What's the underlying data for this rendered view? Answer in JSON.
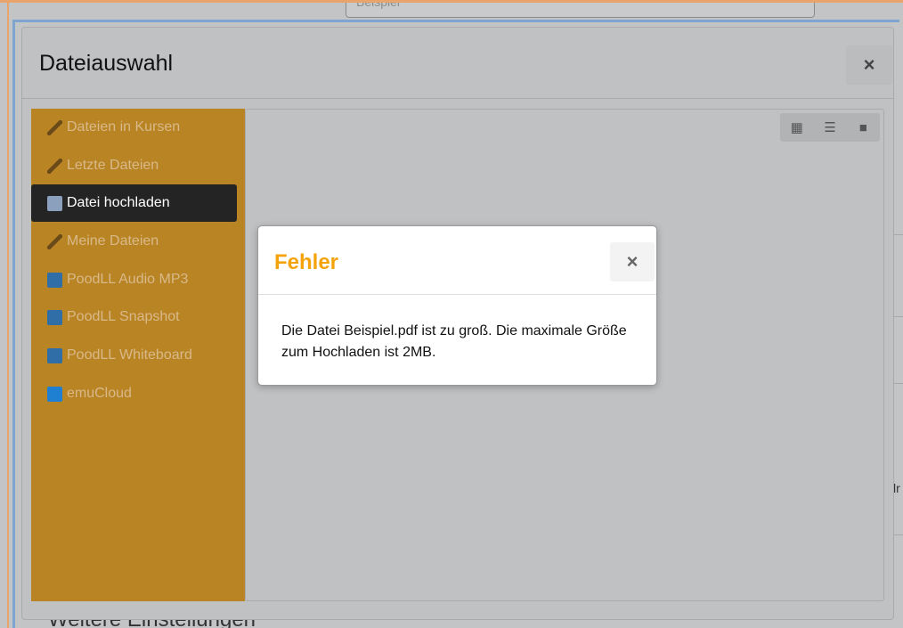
{
  "background": {
    "example_placeholder": "Beispiel",
    "more_settings": "Weitere Einstellungen",
    "right_fragment": "lr"
  },
  "modal": {
    "title": "Dateiauswahl",
    "close_label": "×"
  },
  "sidebar": {
    "items": [
      {
        "label": "Dateien in Kursen",
        "icon": "graduation-cap-icon",
        "active": false
      },
      {
        "label": "Letzte Dateien",
        "icon": "graduation-cap-icon",
        "active": false
      },
      {
        "label": "Datei hochladen",
        "icon": "upload-icon",
        "active": true
      },
      {
        "label": "Meine Dateien",
        "icon": "graduation-cap-icon",
        "active": false
      },
      {
        "label": "PoodLL Audio MP3",
        "icon": "poodll-icon",
        "active": false
      },
      {
        "label": "PoodLL Snapshot",
        "icon": "poodll-icon",
        "active": false
      },
      {
        "label": "PoodLL Whiteboard",
        "icon": "poodll-icon",
        "active": false
      },
      {
        "label": "emuCloud",
        "icon": "nextcloud-icon",
        "active": false
      }
    ]
  },
  "toolbar": {
    "icons": [
      "grid-view-icon",
      "list-view-icon",
      "folder-view-icon"
    ]
  },
  "error_dialog": {
    "title": "Fehler",
    "close_label": "×",
    "message": "Die Datei Beispiel.pdf ist zu groß. Die maximale Größe zum Hochladen ist 2MB."
  },
  "colors": {
    "sidebar_bg": "#b88424",
    "error_title": "#f5a30a",
    "active_item_bg": "#242424"
  }
}
